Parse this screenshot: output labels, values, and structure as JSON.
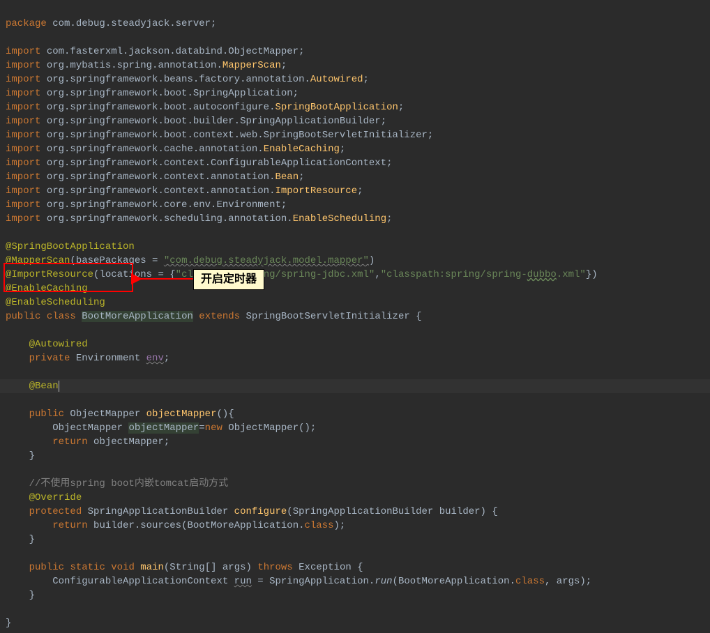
{
  "code": {
    "l01_kw": "package",
    "l01_rest": " com.debug.steadyjack.server;",
    "l02": "",
    "l03_kw": "import",
    "l03_rest": " com.fasterxml.jackson.databind.ObjectMapper;",
    "l04_kw": "import",
    "l04_rest1": " org.mybatis.spring.annotation.",
    "l04_cls": "MapperScan",
    "l04_sc": ";",
    "l05_kw": "import",
    "l05_rest1": " org.springframework.beans.factory.annotation.",
    "l05_cls": "Autowired",
    "l05_sc": ";",
    "l06_kw": "import",
    "l06_rest1": " org.springframework.boot.SpringApplication;",
    "l07_kw": "import",
    "l07_rest1": " org.springframework.boot.autoconfigure.",
    "l07_cls": "SpringBootApplication",
    "l07_sc": ";",
    "l08_kw": "import",
    "l08_rest1": " org.springframework.boot.builder.SpringApplicationBuilder;",
    "l09_kw": "import",
    "l09_rest1": " org.springframework.boot.context.web.SpringBootServletInitializer;",
    "l10_kw": "import",
    "l10_rest1": " org.springframework.cache.annotation.",
    "l10_cls": "EnableCaching",
    "l10_sc": ";",
    "l11_kw": "import",
    "l11_rest1": " org.springframework.context.ConfigurableApplicationContext;",
    "l12_kw": "import",
    "l12_rest1": " org.springframework.context.annotation.",
    "l12_cls": "Bean",
    "l12_sc": ";",
    "l13_kw": "import",
    "l13_rest1": " org.springframework.context.annotation.",
    "l13_cls": "ImportResource",
    "l13_sc": ";",
    "l14_kw": "import",
    "l14_rest1": " org.springframework.core.env.Environment;",
    "l15_kw": "import",
    "l15_rest1": " org.springframework.scheduling.annotation.",
    "l15_cls": "EnableScheduling",
    "l15_sc": ";",
    "l16": "",
    "l17": "@SpringBootApplication",
    "l18_a": "@MapperScan",
    "l18_p1": "(",
    "l18_param": "basePackages",
    "l18_eq": " = ",
    "l18_str": "\"com.debug.steadyjack.model.mapper\"",
    "l18_p2": ")",
    "l19_a": "@ImportResource",
    "l19_p1": "(",
    "l19_param": "locations",
    "l19_eq": " = {",
    "l19_str1": "\"classpath:spring/spring-jdbc.xml\"",
    "l19_comma": ",",
    "l19_str2a": "\"classpath:spring/spring-",
    "l19_str2b": "dubbo",
    "l19_str2c": ".xml\"",
    "l19_p2": "})",
    "l20": "@EnableCaching",
    "l21": "@EnableScheduling",
    "l22_kw1": "public",
    "l22_kw2": "class",
    "l22_cls": "BootMoreApplication",
    "l22_kw3": "extends",
    "l22_sup": "SpringBootServletInitializer {",
    "l23": "",
    "l24_ind": "    ",
    "l24_a": "@Autowired",
    "l25_ind": "    ",
    "l25_kw": "private",
    "l25_typ": " Environment ",
    "l25_var": "env",
    "l25_sc": ";",
    "l26": "",
    "l27_ind": "    ",
    "l27_a": "@Bean",
    "l28_ind": "    ",
    "l28_kw": "public",
    "l28_typ": " ObjectMapper ",
    "l28_m": "objectMapper",
    "l28_rest": "(){",
    "l29_ind": "        ",
    "l29_typ": "ObjectMapper ",
    "l29_var": "objectMapper",
    "l29_eq": "=",
    "l29_kw": "new",
    "l29_rest": " ObjectMapper();",
    "l30_ind": "        ",
    "l30_kw": "return",
    "l30_rest": " objectMapper;",
    "l31_ind": "    ",
    "l31_rest": "}",
    "l32": "",
    "l33_ind": "    ",
    "l33_c": "//不使用spring boot内嵌tomcat启动方式",
    "l34_ind": "    ",
    "l34_a": "@Override",
    "l35_ind": "    ",
    "l35_kw": "protected",
    "l35_typ": " SpringApplicationBuilder ",
    "l35_m": "configure",
    "l35_rest": "(SpringApplicationBuilder builder) {",
    "l36_ind": "        ",
    "l36_kw": "return",
    "l36_rest1": " builder.sources(BootMoreApplication.",
    "l36_kw2": "class",
    "l36_rest2": ");",
    "l37_ind": "    ",
    "l37_rest": "}",
    "l38": "",
    "l39_ind": "    ",
    "l39_kw1": "public",
    "l39_kw2": "static",
    "l39_kw3": "void",
    "l39_m": "main",
    "l39_sig": "(String[] args) ",
    "l39_kw4": "throws",
    "l39_rest": " Exception {",
    "l40_ind": "        ",
    "l40_typ": "ConfigurableApplicationContext ",
    "l40_var": "run",
    "l40_eq": " = SpringApplication.",
    "l40_sm": "run",
    "l40_p1": "(BootMoreApplication.",
    "l40_kw": "class",
    "l40_rest": ", args);",
    "l41_ind": "    ",
    "l41_rest": "}",
    "l42": "",
    "l43": "}"
  },
  "callout_text": "开启定时器"
}
